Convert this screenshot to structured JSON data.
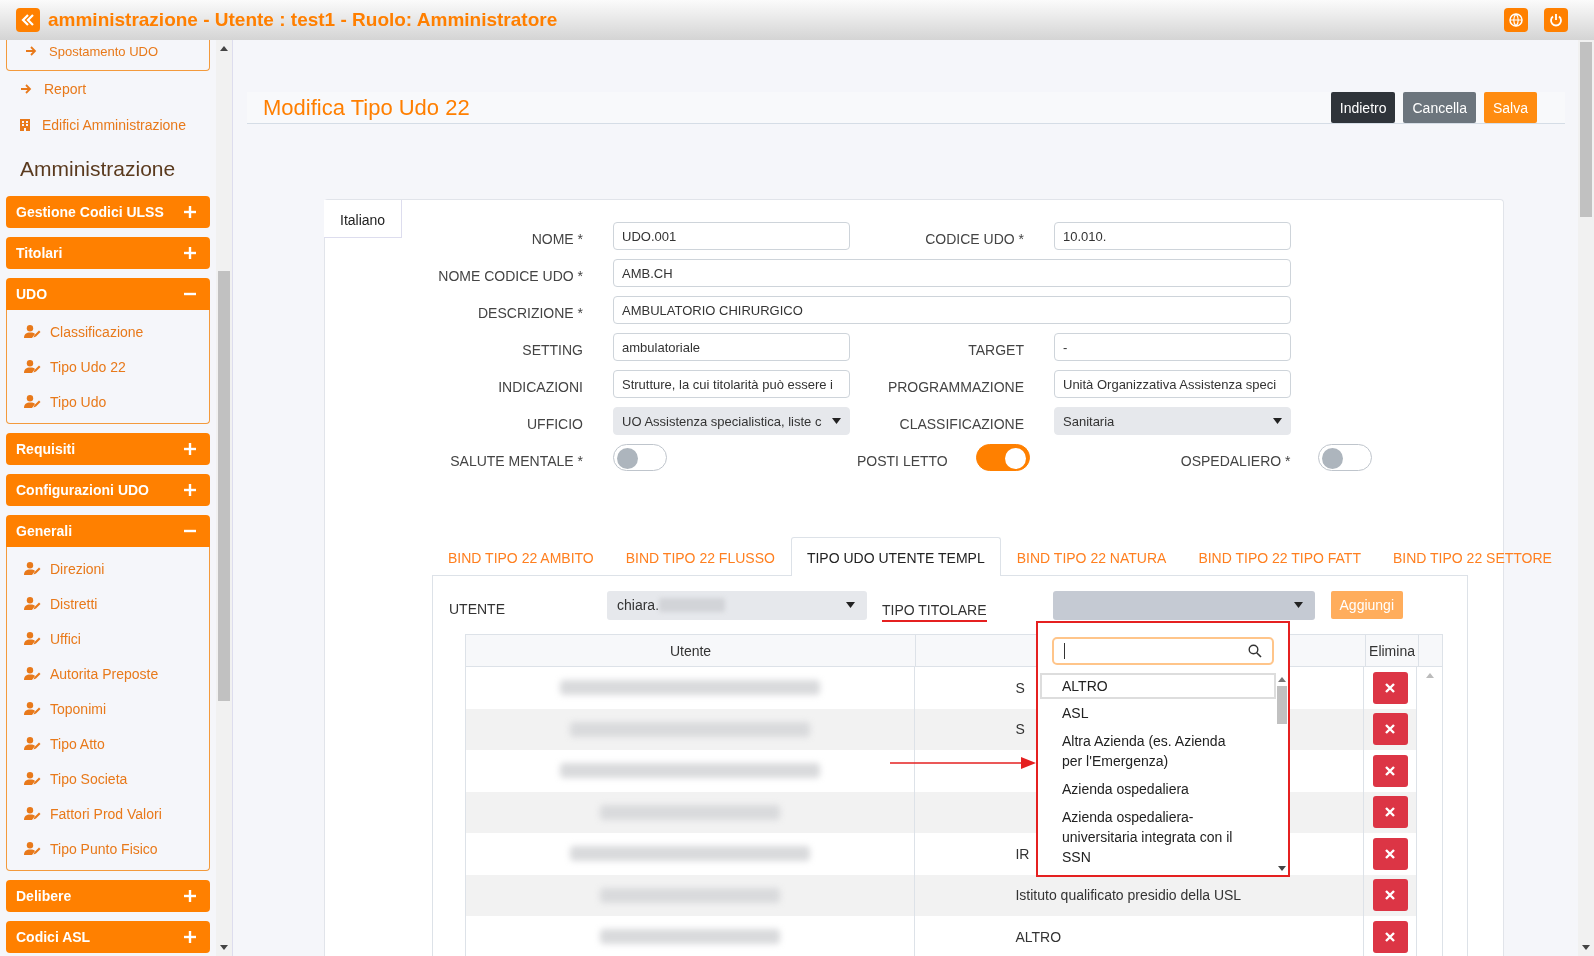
{
  "window": {
    "title": "amministrazione - Utente : test1 - Ruolo: Amministratore"
  },
  "sidebar": {
    "top_item": "Spostamento UDO",
    "links": [
      {
        "label": "Report"
      },
      {
        "label": "Edifici Amministrazione"
      }
    ],
    "section_title": "Amministrazione",
    "groups": [
      {
        "label": "Gestione Codici ULSS",
        "expanded": false
      },
      {
        "label": "Titolari",
        "expanded": false
      },
      {
        "label": "UDO",
        "expanded": true,
        "children": [
          "Classificazione",
          "Tipo Udo 22",
          "Tipo Udo"
        ]
      },
      {
        "label": "Requisiti",
        "expanded": false
      },
      {
        "label": "Configurazioni UDO",
        "expanded": false
      },
      {
        "label": "Generali",
        "expanded": true,
        "children": [
          "Direzioni",
          "Distretti",
          "Uffici",
          "Autorita Preposte",
          "Toponimi",
          "Tipo Atto",
          "Tipo Societa",
          "Fattori Prod Valori",
          "Tipo Punto Fisico"
        ]
      },
      {
        "label": "Delibere",
        "expanded": false
      },
      {
        "label": "Codici ASL",
        "expanded": false
      }
    ]
  },
  "page": {
    "title": "Modifica Tipo Udo 22",
    "buttons": [
      {
        "label": "Indietro",
        "kind": "dark"
      },
      {
        "label": "Cancella",
        "kind": "secondary"
      },
      {
        "label": "Salva",
        "kind": "primary"
      }
    ]
  },
  "language_tab": "Italiano",
  "form_rows": [
    [
      {
        "label": "NOME *",
        "kind": "text",
        "value": "UDO.001"
      },
      {
        "label": "CODICE UDO *",
        "kind": "text",
        "value": "10.010."
      }
    ],
    [
      {
        "label": "NOME CODICE UDO *",
        "kind": "text",
        "value": "AMB.CH"
      }
    ],
    [
      {
        "label": "DESCRIZIONE *",
        "kind": "text",
        "value": "AMBULATORIO CHIRURGICO"
      }
    ],
    [
      {
        "label": "SETTING",
        "kind": "text",
        "value": "ambulatoriale"
      },
      {
        "label": "TARGET",
        "kind": "text",
        "value": "-"
      }
    ],
    [
      {
        "label": "INDICAZIONI",
        "kind": "text",
        "value": "Strutture, la cui titolarità può essere i"
      },
      {
        "label": "PROGRAMMAZIONE",
        "kind": "text",
        "value": "Unità Organizzativa Assistenza speci"
      }
    ],
    [
      {
        "label": "UFFICIO",
        "kind": "select",
        "value": "UO Assistenza specialistica, liste c"
      },
      {
        "label": "CLASSIFICAZIONE",
        "kind": "select",
        "value": "Sanitaria"
      }
    ]
  ],
  "toggles": [
    {
      "label": "SALUTE MENTALE *",
      "on": false
    },
    {
      "label": "POSTI LETTO",
      "on": true
    },
    {
      "label": "OSPEDALIERO *",
      "on": false
    }
  ],
  "tabs": [
    {
      "label": "BIND TIPO 22 AMBITO",
      "selected": false
    },
    {
      "label": "BIND TIPO 22 FLUSSO",
      "selected": false
    },
    {
      "label": "TIPO UDO UTENTE TEMPL",
      "selected": true
    },
    {
      "label": "BIND TIPO 22 NATURA",
      "selected": false
    },
    {
      "label": "BIND TIPO 22 TIPO FATT",
      "selected": false
    },
    {
      "label": "BIND TIPO 22 SETTORE",
      "selected": false
    }
  ],
  "filter": {
    "utente_label": "UTENTE",
    "utente_value": "chiara.",
    "tipo_label": "TIPO TITOLARE",
    "add_button": "Aggiungi"
  },
  "table": {
    "columns": [
      "Utente",
      "Elimina"
    ],
    "rows": [
      {
        "titolare": "S"
      },
      {
        "titolare": "S"
      },
      {},
      {},
      {
        "titolare": "IR"
      },
      {
        "titolare": "Istituto qualificato presidio della USL"
      },
      {
        "titolare": "ALTRO"
      }
    ]
  },
  "dropdown": {
    "options": [
      {
        "label": "ALTRO",
        "selected": true
      },
      {
        "label": "ASL",
        "selected": false
      },
      {
        "label": "Altra Azienda (es. Azienda per l'Emergenza)",
        "selected": false
      },
      {
        "label": "Azienda ospedaliera",
        "selected": false
      },
      {
        "label": "Azienda ospedaliera-universitaria integrata con il SSN",
        "selected": false
      }
    ]
  }
}
